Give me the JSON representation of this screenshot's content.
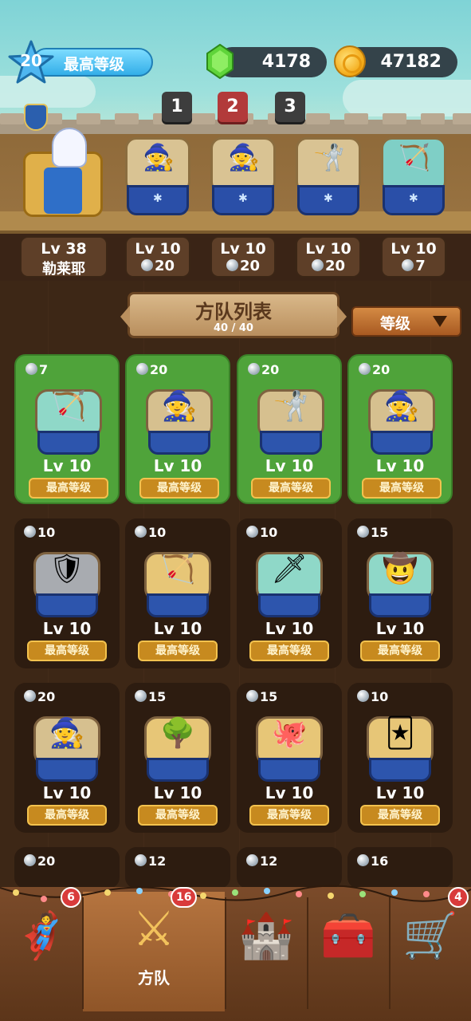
{
  "header": {
    "player_level": "20",
    "level_label": "最高等级",
    "gems": "4178",
    "coins": "47182"
  },
  "team_pages": [
    {
      "label": "1",
      "active": false
    },
    {
      "label": "2",
      "active": true
    },
    {
      "label": "3",
      "active": false
    }
  ],
  "team": [
    {
      "level": "Lv 38",
      "sub": "勒莱耶",
      "cost": ""
    },
    {
      "level": "Lv 10",
      "sub": "",
      "cost": "20"
    },
    {
      "level": "Lv 10",
      "sub": "",
      "cost": "20"
    },
    {
      "level": "Lv 10",
      "sub": "",
      "cost": "20"
    },
    {
      "level": "Lv 10",
      "sub": "",
      "cost": "7"
    }
  ],
  "list": {
    "title": "方队列表",
    "count": "40 / 40",
    "sort_label": "等级"
  },
  "cards": [
    {
      "cost": "7",
      "level": "Lv 10",
      "tag": "最高等级",
      "icon": "archer-on-grass"
    },
    {
      "cost": "20",
      "level": "Lv 10",
      "tag": "最高等级",
      "icon": "fire-wizard"
    },
    {
      "cost": "20",
      "level": "Lv 10",
      "tag": "最高等级",
      "icon": "white-knight"
    },
    {
      "cost": "20",
      "level": "Lv 10",
      "tag": "最高等级",
      "icon": "dark-mage"
    },
    {
      "cost": "10",
      "level": "Lv 10",
      "tag": "最高等级",
      "icon": "armored-knight"
    },
    {
      "cost": "10",
      "level": "Lv 10",
      "tag": "最高等级",
      "icon": "crossbowman"
    },
    {
      "cost": "10",
      "level": "Lv 10",
      "tag": "最高等级",
      "icon": "spear-maiden"
    },
    {
      "cost": "15",
      "level": "Lv 10",
      "tag": "最高等级",
      "icon": "cowboy-rider"
    },
    {
      "cost": "20",
      "level": "Lv 10",
      "tag": "最高等级",
      "icon": "ice-wizard"
    },
    {
      "cost": "15",
      "level": "Lv 10",
      "tag": "最高等级",
      "icon": "bush-ambusher"
    },
    {
      "cost": "15",
      "level": "Lv 10",
      "tag": "最高等级",
      "icon": "pink-octopus"
    },
    {
      "cost": "10",
      "level": "Lv 10",
      "tag": "最高等级",
      "icon": "jester"
    },
    {
      "cost": "20",
      "level": "",
      "tag": "",
      "icon": "unit"
    },
    {
      "cost": "12",
      "level": "",
      "tag": "",
      "icon": "unit"
    },
    {
      "cost": "12",
      "level": "",
      "tag": "",
      "icon": "unit"
    },
    {
      "cost": "16",
      "level": "",
      "tag": "",
      "icon": "unit"
    }
  ],
  "nav": {
    "items": [
      {
        "icon": "hero-icon",
        "badge": "6"
      },
      {
        "icon": "squad-icon",
        "badge": "16",
        "label": "方队",
        "active": true
      },
      {
        "icon": "castle-icon",
        "badge": ""
      },
      {
        "icon": "chest-icon",
        "badge": ""
      },
      {
        "icon": "cart-icon",
        "badge": "4"
      }
    ]
  }
}
